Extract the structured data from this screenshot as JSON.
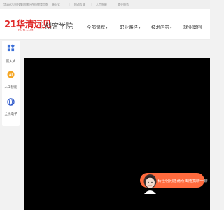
{
  "topbar": {
    "notice": "华清远见科技集团旗下在线教育品牌",
    "links": [
      "嵌入式",
      "移动互联",
      "人工智能",
      "就业服务"
    ]
  },
  "header": {
    "logo_main": "华清远见",
    "logo_prefix": "21",
    "logo_sub": "HQYJ.COM",
    "brand": "创客学院",
    "nav": [
      {
        "label": "全部课程",
        "has_caret": true
      },
      {
        "label": "职业路径",
        "has_caret": true
      },
      {
        "label": "技术问答",
        "has_caret": true
      },
      {
        "label": "就业案例",
        "has_caret": false
      }
    ]
  },
  "sidebar": {
    "items": [
      {
        "label": "嵌入式",
        "icon": "chip-icon"
      },
      {
        "label": "人工智能",
        "icon": "ai-icon"
      },
      {
        "label": "全栈电子",
        "icon": "globe-icon"
      }
    ]
  },
  "chat": {
    "label": "有任何问题请点击随我聊一聊"
  },
  "colors": {
    "accent": "#ff6a3d",
    "logo_red": "#e02a2a",
    "video_bg": "#000000"
  }
}
